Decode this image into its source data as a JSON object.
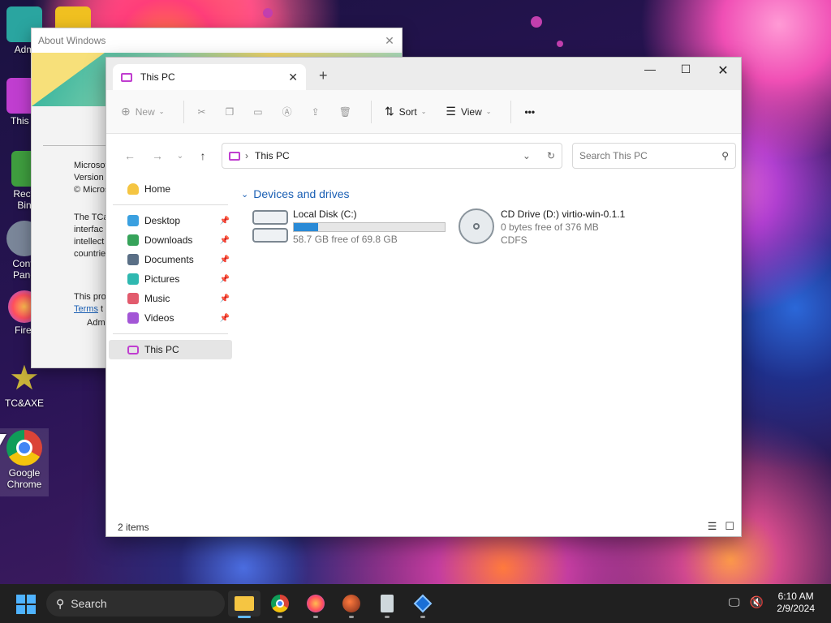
{
  "about": {
    "title": "About Windows",
    "lines": [
      "Microsof",
      "Version",
      "© Micros"
    ],
    "para": [
      "The TCa",
      "interfac",
      "intellect",
      "countrie"
    ],
    "license": "This pro",
    "terms_link": "Terms",
    "terms_after": " t",
    "licensee": "Admi"
  },
  "desktop": {
    "icons": [
      {
        "label": "Adm"
      },
      {
        "label": "This P"
      },
      {
        "label": "Recy\nBin"
      },
      {
        "label": "Contr\nPane"
      },
      {
        "label": "Firef"
      },
      {
        "label": "TC&AXE"
      },
      {
        "label": "Google\nChrome"
      }
    ]
  },
  "explorer": {
    "tab_title": "This PC",
    "toolbar": {
      "new_label": "New",
      "sort_label": "Sort",
      "view_label": "View",
      "more_label": "•••"
    },
    "address": {
      "path": "This PC",
      "search_placeholder": "Search This PC"
    },
    "nav": {
      "home": "Home",
      "pinned": [
        {
          "label": "Desktop",
          "color": "#3aa0e0"
        },
        {
          "label": "Downloads",
          "color": "#36a35a"
        },
        {
          "label": "Documents",
          "color": "#5a6f86"
        },
        {
          "label": "Pictures",
          "color": "#2fb8b0"
        },
        {
          "label": "Music",
          "color": "#e25b6d"
        },
        {
          "label": "Videos",
          "color": "#a356d6"
        }
      ],
      "this_pc": "This PC"
    },
    "group_title": "Devices and drives",
    "drives": [
      {
        "name": "Local Disk (C:)",
        "free_text": "58.7 GB free of 69.8 GB",
        "used_fraction": 0.16
      },
      {
        "name": "CD Drive (D:) virtio-win-0.1.1",
        "free_text": "0 bytes free of 376 MB",
        "fs": "CDFS"
      }
    ],
    "status": "2 items"
  },
  "taskbar": {
    "search_label": "Search",
    "time": "6:10 AM",
    "date": "2/9/2024"
  },
  "colors": {
    "accent": "#1a5fb4",
    "drive_fill": "#2a8ad6",
    "taskbar": "#202020"
  }
}
